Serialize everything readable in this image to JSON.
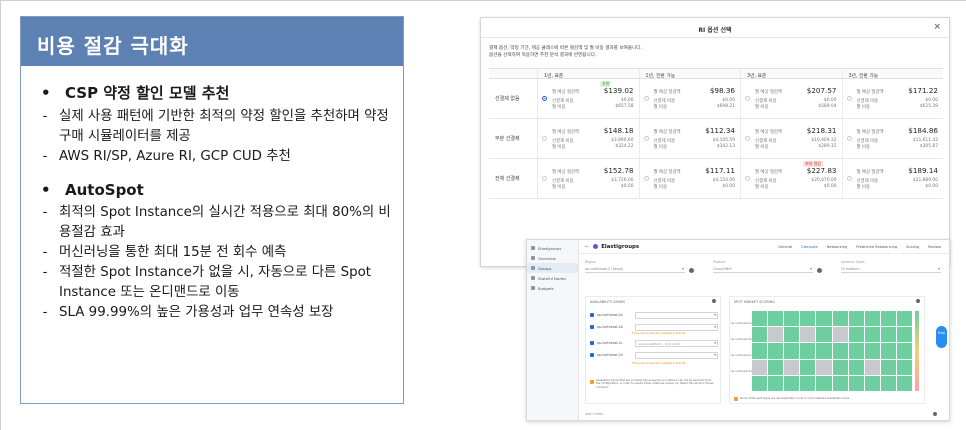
{
  "panel": {
    "title": "비용 절감 극대화",
    "sections": [
      {
        "heading": "CSP 약정 할인 모델 추천",
        "items": [
          "실제 사용 패턴에 기반한 최적의 약정 할인을 추천하며 약정 구매 시뮬레이터를 제공",
          "AWS RI/SP, Azure RI, GCP CUD 추천"
        ]
      },
      {
        "heading": "AutoSpot",
        "items": [
          "최적의 Spot Instance의 실시간 적용으로 최대 80%의 비용절감 효과",
          "머신러닝을 통한 최대 15분 전 회수 예측",
          "적절한 Spot Instance가 없을 시, 자동으로 다른 Spot Instance 또는 온디맨드로 이동",
          "SLA 99.99%의 높은 가용성과 업무 연속성 보장"
        ]
      }
    ]
  },
  "ri_window": {
    "title": "RI 옵션 선택",
    "close": "×",
    "desc1": "결제 옵션, 약정 기간, 제공 클래스에 따른 절감액 및 월 비용 결과를 보여줍니다.",
    "desc2": "옵션을 선택하여 적용하면 추천 분석 결과에 반영됩니다.",
    "columns": [
      "1년, 표준",
      "1년, 전환 가능",
      "3년, 표준",
      "3년, 전환 가능"
    ],
    "labels": {
      "saving": "월 예상 절감액",
      "upfront": "선결제 비용",
      "monthly": "월 비용"
    },
    "badges": {
      "recommend": "추천",
      "max": "최대 절감"
    },
    "rows": [
      {
        "name": "선결제 없음",
        "cells": [
          {
            "saving": "$139.02",
            "upfront": "$0.00",
            "monthly": "$657.58"
          },
          {
            "saving": "$98.36",
            "upfront": "$0.00",
            "monthly": "$698.21"
          },
          {
            "saving": "$207.57",
            "upfront": "$0.00",
            "monthly": "$589.04"
          },
          {
            "saving": "$171.22",
            "upfront": "$0.00",
            "monthly": "$625.39"
          }
        ]
      },
      {
        "name": "부분 선결제",
        "cells": [
          {
            "saving": "$148.18",
            "upfront": "$3,890.60",
            "monthly": "$324.22"
          },
          {
            "saving": "$112.34",
            "upfront": "$4,105.59",
            "monthly": "$342.13"
          },
          {
            "saving": "$218.31",
            "upfront": "$10,409.32",
            "monthly": "$289.15"
          },
          {
            "saving": "$184.86",
            "upfront": "$11,611.42",
            "monthly": "$305.87"
          }
        ]
      },
      {
        "name": "전체 선결제",
        "cells": [
          {
            "saving": "$152.78",
            "upfront": "$3,726.00",
            "monthly": "$0.00"
          },
          {
            "saving": "$117.11",
            "upfront": "$4,154.00",
            "monthly": "$0.00"
          },
          {
            "saving": "$227.83",
            "upfront": "$20,470.00",
            "monthly": "$0.00"
          },
          {
            "saving": "$189.14",
            "upfront": "$21,889.00",
            "monthly": "$0.00"
          }
        ]
      }
    ]
  },
  "eg_window": {
    "sidebar": [
      "Elastigroups",
      "Overview",
      "Groups",
      "Stateful Nodes",
      "Budgets"
    ],
    "back": "←",
    "title": "Elastigroups",
    "tabs": [
      "General",
      "Compute",
      "Networking",
      "Predictive Rebalancing",
      "Scaling",
      "Review"
    ],
    "filter_labels": [
      "Region",
      "Product",
      "Instance Types"
    ],
    "filter_values": [
      "ap-northeast-2 (Seoul)",
      "Linux/UNIX",
      "t3.medium"
    ],
    "availability_title": "AVAILABILITY ZONES",
    "spot_title": "SPOT MARKET SCORING",
    "zones": [
      "ap-northeast-2a",
      "ap-northeast-2b",
      "ap-northeast-2c",
      "ap-northeast-2d"
    ],
    "subnet_hint": "subnet-0a8f4ec5 - 10.0.1.0/24",
    "zone_warning": "There are no subnets available in this AZ",
    "avail_note": "Availability Zones that are currently being used by an instance can not be removed from the configuration, in order to ensure those instances remain up. Select this AZ and choose a Subnet.",
    "spot_note": "Some of the spot types are not supported in one or more selected availability zones",
    "side_tab": "Help",
    "spot_types_label": "SPOT TYPES"
  },
  "colors": {
    "header": "#5e81b3",
    "heat_available": "#6dcf9f",
    "heat_unavailable": "#c7c9cc",
    "accent": "#2a62c9"
  }
}
